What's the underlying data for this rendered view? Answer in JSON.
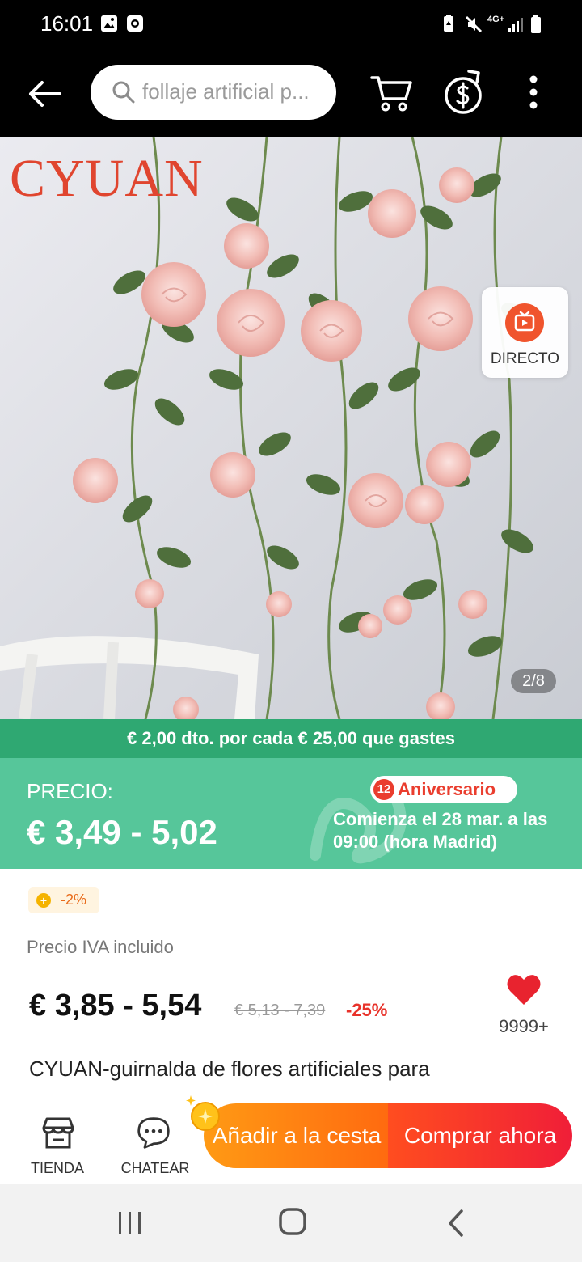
{
  "status_bar": {
    "time": "16:01",
    "network": "4G+"
  },
  "top_bar": {
    "search_text": "follaje artificial p...",
    "icons": [
      "back-arrow-icon",
      "search-icon",
      "cart-icon",
      "coin-exchange-icon",
      "more-vert-icon"
    ]
  },
  "gallery": {
    "brand_watermark": "CYUAN",
    "live_label": "DIRECTO",
    "page_indicator": "2/8"
  },
  "promo": {
    "discount_text": "€ 2,00 dto. por cada € 25,00 que gastes",
    "price_label": "PRECIO:",
    "price_range": "€ 3,49 - 5,02",
    "anniversary_number": "12",
    "anniversary_label": "Aniversario",
    "anniversary_date": "Comienza el 28 mar. a las 09:00 (hora Madrid)"
  },
  "details": {
    "coin_discount": "-2%",
    "vat_note": "Precio IVA incluido",
    "price_current": "€ 3,85 - 5,54",
    "price_original": "€ 5,13 - 7,39",
    "discount_percent": "-25%",
    "wishlist_count": "9999+",
    "title": "CYUAN-guirnalda de flores artificiales para"
  },
  "actions": {
    "store_label": "TIENDA",
    "chat_label": "CHATEAR",
    "add_to_cart_label": "Añadir a la cesta",
    "buy_now_label": "Comprar ahora"
  },
  "colors": {
    "promo_green_dark": "#2fa872",
    "promo_green": "#56c69a",
    "price_red": "#e8322a",
    "cart_orange": "#ff8a12",
    "buy_red": "#f42a30"
  }
}
